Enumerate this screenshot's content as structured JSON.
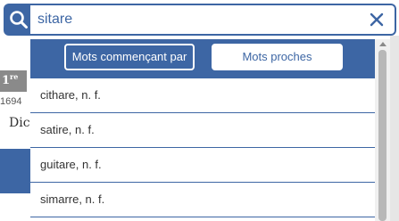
{
  "search": {
    "value": "sitare",
    "icon": "search-icon",
    "clear_icon": "close-icon"
  },
  "filters": {
    "starts_with_label": "Mots commençant par",
    "nearby_label": "Mots proches"
  },
  "results": [
    {
      "label": "cithare, n. f."
    },
    {
      "label": "satire, n. f."
    },
    {
      "label": "guitare, n. f."
    },
    {
      "label": "simarre, n. f."
    }
  ],
  "background": {
    "edition_number": "1",
    "edition_suffix": "re",
    "year": "1694",
    "title_fragment": "Dic"
  },
  "colors": {
    "accent": "#3d66a4",
    "text": "#333333"
  }
}
